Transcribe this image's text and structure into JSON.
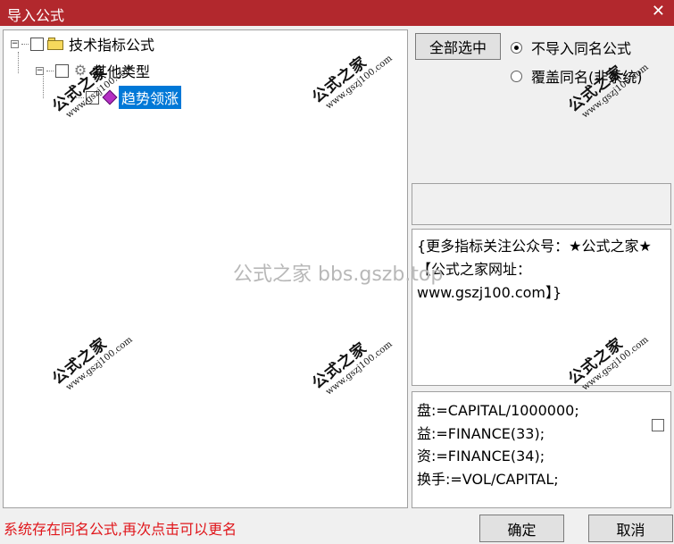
{
  "window": {
    "title": "导入公式",
    "close_glyph": "✕"
  },
  "tree": {
    "root": {
      "label": "技术指标公式",
      "icon": "folder-icon",
      "expander": "−"
    },
    "group": {
      "label": "其他类型",
      "icon": "gear-icon",
      "expander": "−"
    },
    "leaf": {
      "label": "趋势领涨",
      "icon": "formula-icon",
      "selected": true
    }
  },
  "options": {
    "select_all_label": "全部选中",
    "radio_skip_label": "不导入同名公式",
    "radio_overwrite_label": "覆盖同名(非系统)",
    "selected_radio": "skip"
  },
  "description": {
    "text": "{更多指标关注公众号：★公式之家★ 【公式之家网址：www.gszj100.com】}"
  },
  "code": {
    "lines": [
      "盘:=CAPITAL/1000000;",
      "益:=FINANCE(33);",
      "资:=FINANCE(34);",
      "换手:=VOL/CAPITAL;"
    ]
  },
  "footer": {
    "status_text": "系统存在同名公式,再次点击可以更名",
    "ok_label": "确定",
    "cancel_label": "取消"
  },
  "watermarks": {
    "brand": "公式之家",
    "url": "www.gszj100.com",
    "center": "公式之家 bbs.gszb.top"
  },
  "colors": {
    "titlebar": "#b2282d",
    "selection": "#0078d7",
    "status_text": "#e0161b"
  }
}
